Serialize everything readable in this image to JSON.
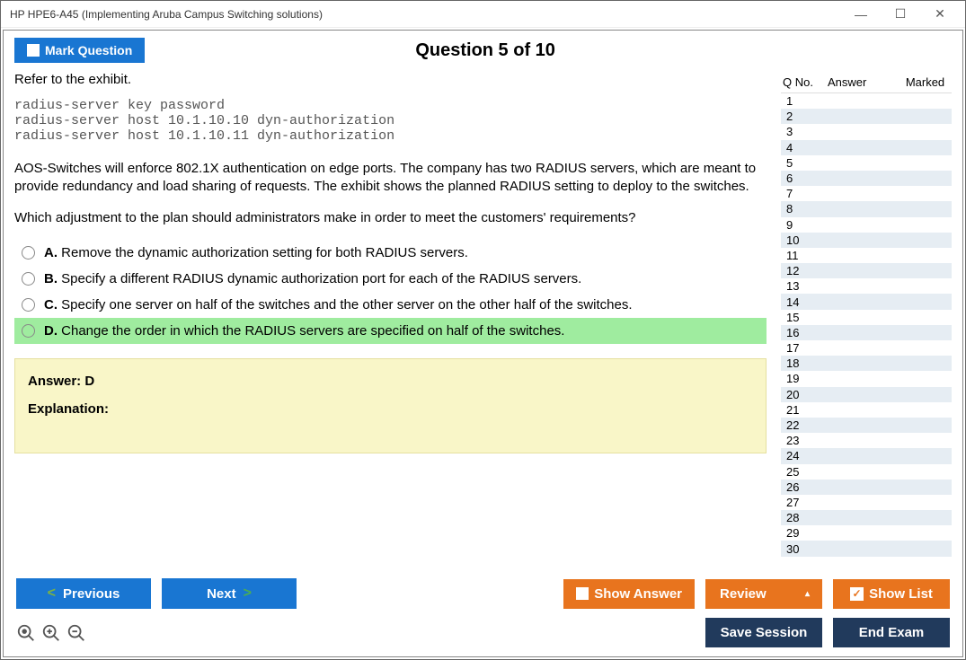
{
  "window": {
    "title": "HP HPE6-A45 (Implementing Aruba Campus Switching solutions)"
  },
  "top": {
    "mark_label": "Mark Question",
    "question_title": "Question 5 of 10"
  },
  "question": {
    "intro": "Refer to the exhibit.",
    "code": "radius-server key password\nradius-server host 10.1.10.10 dyn-authorization\nradius-server host 10.1.10.11 dyn-authorization",
    "p1": "AOS-Switches will enforce 802.1X authentication on edge ports. The company has two RADIUS servers, which are meant to provide redundancy and load sharing of requests. The exhibit shows the planned RADIUS setting to deploy to the switches.",
    "p2": "Which adjustment to the plan should administrators make in order to meet the customers' requirements?",
    "options": {
      "a_letter": "A.",
      "a_text": " Remove the dynamic authorization setting for both RADIUS servers.",
      "b_letter": "B.",
      "b_text": " Specify a different RADIUS dynamic authorization port for each of the RADIUS servers.",
      "c_letter": "C.",
      "c_text": " Specify one server on half of the switches and the other server on the other half of the switches.",
      "d_letter": "D.",
      "d_text": " Change the order in which the RADIUS servers are specified on half of the switches."
    },
    "answer_label": "Answer: D",
    "explanation_label": "Explanation:"
  },
  "side": {
    "h_qno": "Q No.",
    "h_answer": "Answer",
    "h_marked": "Marked",
    "rows": [
      "1",
      "2",
      "3",
      "4",
      "5",
      "6",
      "7",
      "8",
      "9",
      "10",
      "11",
      "12",
      "13",
      "14",
      "15",
      "16",
      "17",
      "18",
      "19",
      "20",
      "21",
      "22",
      "23",
      "24",
      "25",
      "26",
      "27",
      "28",
      "29",
      "30"
    ]
  },
  "bottom": {
    "previous": "Previous",
    "next": "Next",
    "show_answer": "Show Answer",
    "review": "Review",
    "show_list": "Show List",
    "save_session": "Save Session",
    "end_exam": "End Exam"
  }
}
